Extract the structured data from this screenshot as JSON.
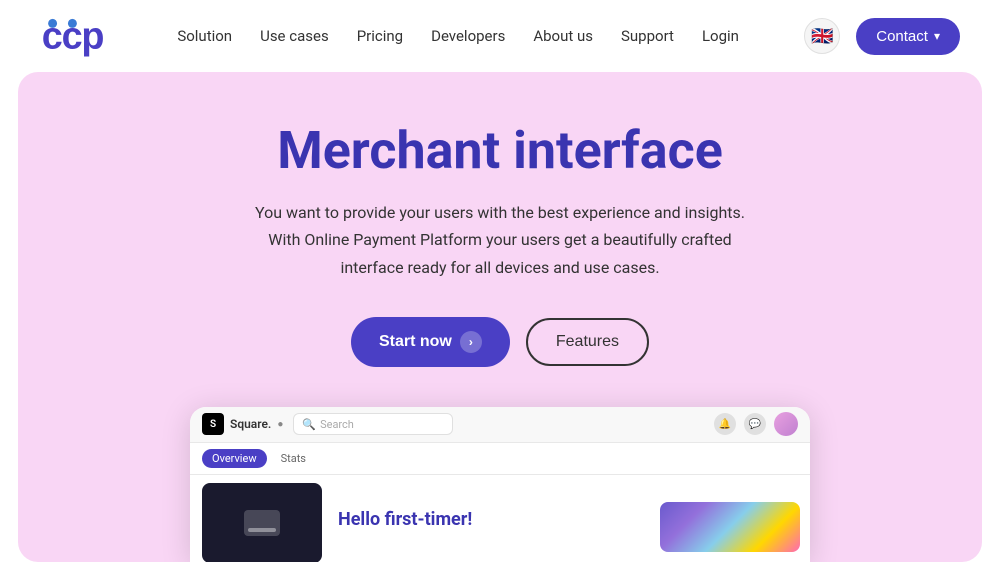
{
  "brand": {
    "name": "ccp",
    "logo_color_c1": "#4a3fc5",
    "logo_color_c2": "#3a7bd5",
    "logo_color_p": "#4a3fc5"
  },
  "header": {
    "nav_items": [
      {
        "label": "Solution",
        "id": "solution"
      },
      {
        "label": "Use cases",
        "id": "use-cases"
      },
      {
        "label": "Pricing",
        "id": "pricing"
      },
      {
        "label": "Developers",
        "id": "developers"
      },
      {
        "label": "About us",
        "id": "about-us"
      },
      {
        "label": "Support",
        "id": "support"
      },
      {
        "label": "Login",
        "id": "login"
      }
    ],
    "lang_flag": "🇬🇧",
    "contact_label": "Contact",
    "contact_chevron": "▾"
  },
  "hero": {
    "title": "Merchant interface",
    "description": "You want to provide your users with the best experience and insights. With Online Payment Platform your users get a beautifully crafted interface ready for all devices and use cases.",
    "cta_primary": "Start now",
    "cta_primary_arrow": "›",
    "cta_secondary": "Features"
  },
  "dashboard": {
    "logo_text": "Square.",
    "search_placeholder": "Search",
    "tab_overview": "Overview",
    "tab_stats": "Stats",
    "greeting": "Hello first-timer!"
  }
}
